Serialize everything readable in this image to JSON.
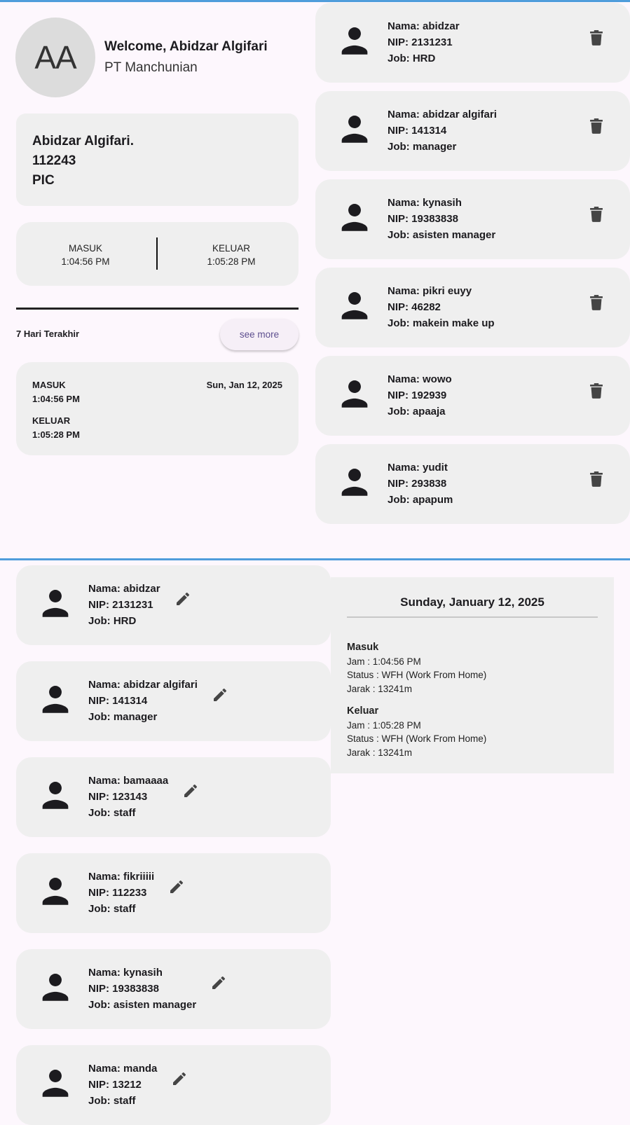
{
  "user": {
    "avatar_initials": "AA",
    "welcome": "Welcome, Abidzar Algifari",
    "company": "PT Manchunian",
    "profile_name": "Abidzar Algifari.",
    "profile_nip": "112243",
    "profile_role": "PIC"
  },
  "attendance_today": {
    "masuk_label": "MASUK",
    "masuk_time": "1:04:56 PM",
    "keluar_label": "KELUAR",
    "keluar_time": "1:05:28 PM"
  },
  "recent": {
    "title": "7 Hari Terakhir",
    "see_more": "see more",
    "entry": {
      "masuk_label": "MASUK",
      "masuk_time": "1:04:56 PM",
      "keluar_label": "KELUAR",
      "keluar_time": "1:05:28 PM",
      "date": "Sun, Jan 12, 2025"
    }
  },
  "employees_delete": [
    {
      "nama": "Nama: abidzar",
      "nip": "NIP: 2131231",
      "job": "Job: HRD"
    },
    {
      "nama": "Nama: abidzar algifari",
      "nip": "NIP: 141314",
      "job": "Job: manager"
    },
    {
      "nama": "Nama: kynasih",
      "nip": "NIP: 19383838",
      "job": "Job: asisten manager"
    },
    {
      "nama": "Nama: pikri euyy",
      "nip": "NIP: 46282",
      "job": "Job: makein make up"
    },
    {
      "nama": "Nama: wowo",
      "nip": "NIP: 192939",
      "job": "Job: apaaja"
    },
    {
      "nama": "Nama: yudit",
      "nip": "NIP: 293838",
      "job": "Job: apapum"
    }
  ],
  "employees_edit": [
    {
      "nama": "Nama: abidzar",
      "nip": "NIP: 2131231",
      "job": "Job: HRD"
    },
    {
      "nama": "Nama: abidzar algifari",
      "nip": "NIP: 141314",
      "job": "Job: manager"
    },
    {
      "nama": "Nama: bamaaaa",
      "nip": "NIP: 123143",
      "job": "Job: staff"
    },
    {
      "nama": "Nama: fikriiiii",
      "nip": "NIP: 112233",
      "job": "Job: staff"
    },
    {
      "nama": "Nama: kynasih",
      "nip": "NIP: 19383838",
      "job": "Job: asisten manager"
    },
    {
      "nama": "Nama: manda",
      "nip": "NIP: 13212",
      "job": "Job: staff"
    }
  ],
  "detail": {
    "date": "Sunday, January 12, 2025",
    "masuk_title": "Masuk",
    "masuk_jam": "Jam : 1:04:56 PM",
    "masuk_status": "Status : WFH (Work From Home)",
    "masuk_jarak": "Jarak : 13241m",
    "keluar_title": "Keluar",
    "keluar_jam": "Jam : 1:05:28 PM",
    "keluar_status": "Status : WFH (Work From Home)",
    "keluar_jarak": "Jarak : 13241m"
  },
  "colors": {
    "background": "#fdf7fd",
    "card": "#efefef",
    "screen_divider": "#4f9ddb",
    "button_text": "#5e4f8f"
  }
}
